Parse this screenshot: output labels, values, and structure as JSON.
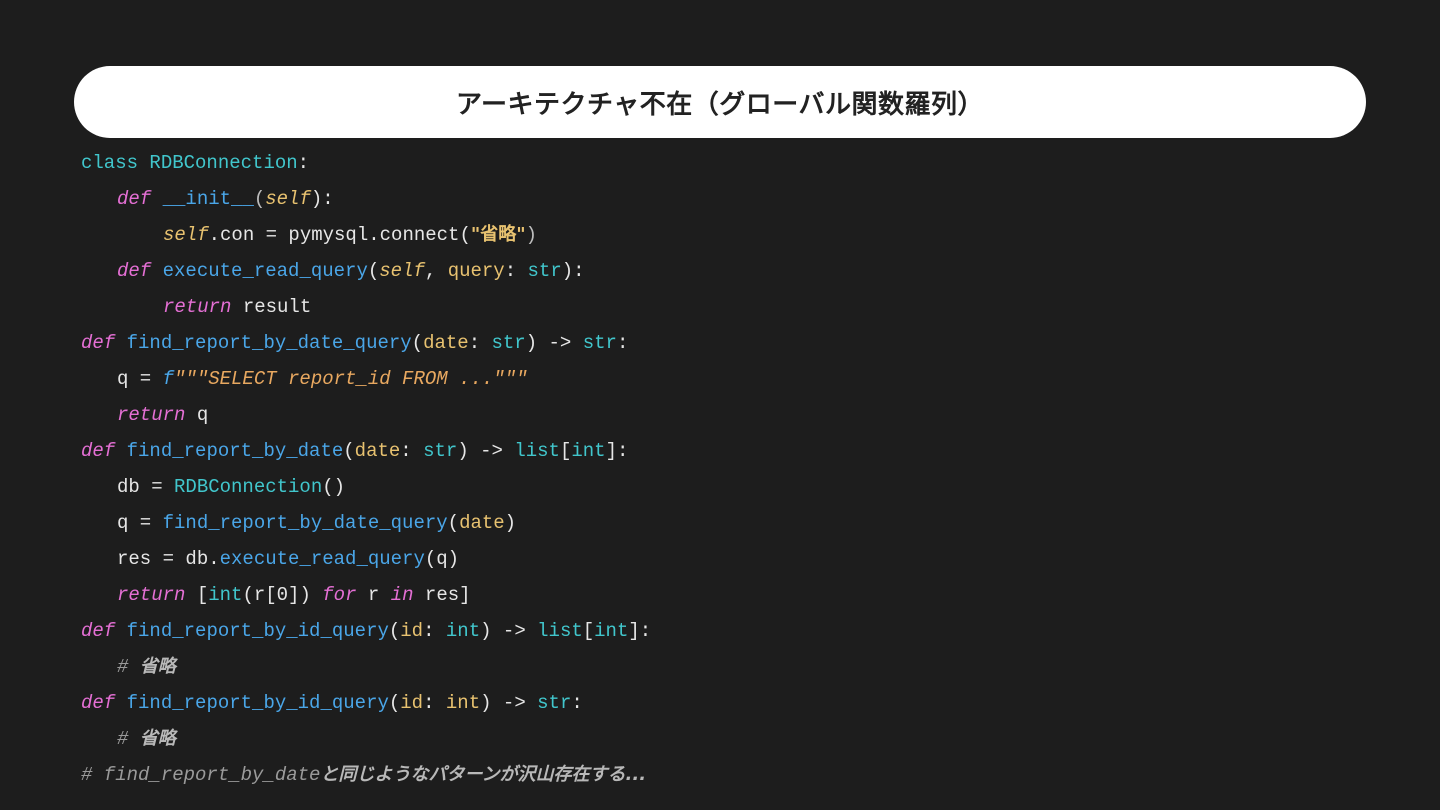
{
  "title": "アーキテクチャ不在（グローバル関数羅列）",
  "code": {
    "l1": {
      "kw": "class",
      "name": "RDBConnection",
      "colon": ":"
    },
    "l2": {
      "kw": "def",
      "name": "__init__",
      "open": "(",
      "self": "self",
      "close": "):"
    },
    "l3": {
      "self": "self",
      "rest": ".con = pymysql.connect(",
      "str": "\"省略\"",
      "close": ")"
    },
    "l4": {
      "kw": "def",
      "name": "execute_read_query",
      "open": "(",
      "self": "self",
      "sep": ", ",
      "param": "query",
      "colon": ": ",
      "type": "str",
      "close": "):"
    },
    "l5": {
      "kw": "return",
      "rest": " result"
    },
    "l6": {
      "kw": "def",
      "name": "find_report_by_date_query",
      "open": "(",
      "param": "date",
      "colon": ": ",
      "type": "str",
      "arrow": ") -> ",
      "ret": "str",
      "end": ":"
    },
    "l7": {
      "lhs": "q = ",
      "fpre": "f",
      "str": "\"\"\"SELECT report_id FROM ...\"\"\""
    },
    "l8": {
      "kw": "return",
      "rest": " q"
    },
    "l9": {
      "kw": "def",
      "name": "find_report_by_date",
      "open": "(",
      "param": "date",
      "colon": ": ",
      "type": "str",
      "arrow": ") -> ",
      "ret": "list",
      "b1": "[",
      "ret2": "int",
      "end": "]:"
    },
    "l10": {
      "lhs": "db = ",
      "name": "RDBConnection",
      "rest": "()"
    },
    "l11": {
      "lhs": "q = ",
      "name": "find_report_by_date_query",
      "open": "(",
      "param": "date",
      "close": ")"
    },
    "l12": {
      "lhs": "res = db.",
      "name": "execute_read_query",
      "rest": "(q)"
    },
    "l13": {
      "kw": "return",
      "a": " [",
      "fn": "int",
      "b": "(r[0]) ",
      "kw2": "for",
      "c": " r ",
      "kw3": "in",
      "d": " res]"
    },
    "l14": {
      "kw": "def",
      "name": "find_report_by_id_query",
      "open": "(",
      "param": "id",
      "colon": ": ",
      "type": "int",
      "arrow": ") -> ",
      "ret": "list",
      "b1": "[",
      "ret2": "int",
      "end": "]:"
    },
    "l15": {
      "hash": "# ",
      "text": "省略"
    },
    "l16": {
      "kw": "def",
      "name": "find_report_by_id_query",
      "open": "(",
      "param": "id",
      "colon": ": ",
      "type": "int",
      "arrow": ") -> ",
      "ret": "str",
      "end": ":"
    },
    "l17": {
      "hash": "# ",
      "text": "省略"
    },
    "l18": {
      "code": "# find_report_by_date",
      "text": "と同じようなパターンが沢山存在する..."
    }
  }
}
